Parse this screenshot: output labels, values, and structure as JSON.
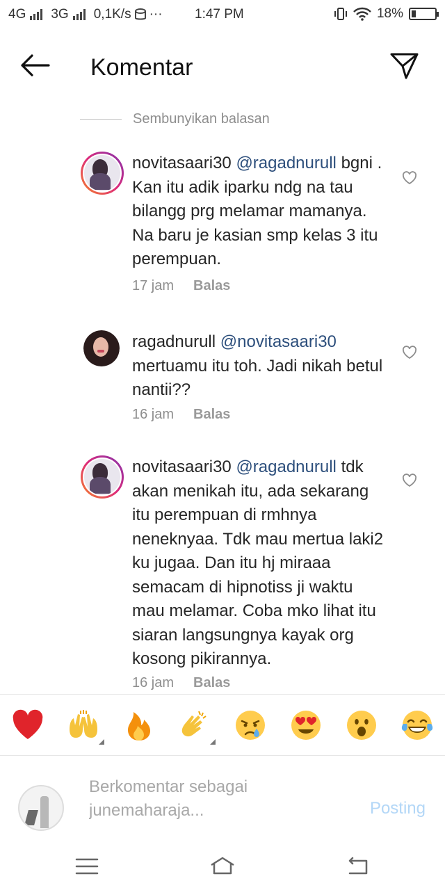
{
  "status_bar": {
    "net1": "4G",
    "net2": "3G",
    "speed": "0,1K/s",
    "dots": "···",
    "time": "1:47 PM",
    "battery": "18%",
    "battery_level": 0.18
  },
  "header": {
    "title": "Komentar"
  },
  "hide_replies": "Sembunyikan balasan",
  "comments": [
    {
      "user": "novitasaari30",
      "mention": "@ragadnurull",
      "text": "bgni . Kan itu adik iparku ndg na tau bilangg prg melamar mamanya. Na baru je kasian smp kelas 3 itu perempuan.",
      "time": "17 jam",
      "reply": "Balas"
    },
    {
      "user": "ragadnurull",
      "mention": "@novitasaari30",
      "text": "mertuamu itu toh. Jadi nikah betul nantii??",
      "time": "16 jam",
      "reply": "Balas"
    },
    {
      "user": "novitasaari30",
      "mention": "@ragadnurull",
      "text": "tdk akan menikah itu, ada sekarang itu perempuan di rmhnya neneknyaa. Tdk mau mertua laki2 ku jugaa. Dan itu hj miraaa semacam di hipnotiss ji waktu mau melamar. Coba mko lihat itu siaran langsungnya kayak org kosong pikirannya.",
      "time": "16 jam",
      "reply": "Balas"
    }
  ],
  "emojis": [
    "❤️",
    "🙌",
    "🔥",
    "👏",
    "😢",
    "😍",
    "😮",
    "😂"
  ],
  "input": {
    "placeholder": "Berkomentar sebagai junemaharaja...",
    "post_label": "Posting"
  },
  "colors": {
    "mention": "#2d4f7c",
    "meta": "#8e8e8e",
    "post_disabled": "#b3d7f7"
  }
}
